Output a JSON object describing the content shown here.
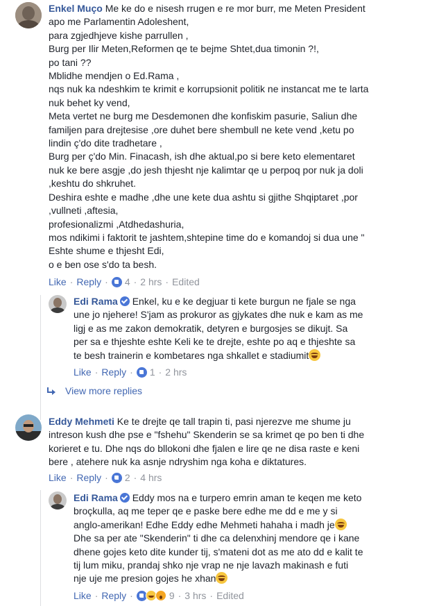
{
  "comments": [
    {
      "author": "Enkel Muço",
      "lines": [
        "Me ke do e nisesh rrugen e re mor burr, me Meten President",
        "apo me Parlamentin Adoleshent,",
        "para zgjedhjeve kishe parrullen ,",
        "Burg per Ilir Meten,Reformen qe te bejme Shtet,dua timonin ?!,",
        "po tani ??",
        "Mblidhe mendjen o Ed.Rama ,",
        "nqs nuk ka ndeshkim te krimit e korrupsionit politik ne instancat me te larta",
        "nuk behet ky vend,",
        "Meta vertet ne burg me Desdemonen dhe konfiskim pasurie, Saliun dhe",
        "familjen para drejtesise ,ore duhet bere shembull ne kete vend ,ketu po",
        "lindin ç'do dite tradhetare ,",
        "Burg per ç'do Min. Finacash, ish dhe aktual,po si bere keto elementaret",
        "nuk ke bere asgje ,do jesh thjesht nje kalimtar qe u perpoq por nuk ja doli",
        ",keshtu do shkruhet.",
        "Deshira eshte e madhe ,dhe une kete dua ashtu si gjithe Shqiptaret ,por",
        ",vullneti ,aftesia,",
        "profesionalizmi ,Atdhedashuria,",
        "mos ndikimi i faktorit te jashtem,shtepine time do e komandoj si dua une \"",
        "Eshte shume e thjesht Edi,",
        "o e ben ose s'do ta besh."
      ],
      "actions": {
        "like": "Like",
        "reply": "Reply",
        "reactions": "4",
        "time": "2 hrs",
        "edited": "Edited"
      }
    },
    {
      "author": "Edi Rama",
      "lines": [
        "Enkel, ku e ke degjuar ti kete burgun ne fjale se nga",
        "une jo njehere! S'jam as prokuror as gjykates dhe nuk e kam as me",
        "ligj e as me zakon demokratik, detyren e burgosjes se dikujt. Sa",
        "per sa e thjeshte eshte Keli ke te drejte, eshte po aq e thjeshte sa",
        "te besh trainerin e kombetares nga shkallet e stadiumit"
      ],
      "actions": {
        "like": "Like",
        "reply": "Reply",
        "reactions": "1",
        "time": "2 hrs"
      }
    },
    {
      "more_replies": "View more replies"
    },
    {
      "author": "Eddy Mehmeti",
      "lines": [
        "Ke te drejte qe tall trapin ti, pasi njerezve me shume ju",
        "intreson kush dhe pse e \"fshehu\" Skenderin se sa krimet qe po ben ti dhe",
        "korieret e tu. Dhe nqs do bllokoni dhe fjalen e lire qe ne disa raste e keni",
        "bere , atehere nuk ka asnje ndryshim nga koha e diktatures."
      ],
      "actions": {
        "like": "Like",
        "reply": "Reply",
        "reactions": "2",
        "time": "4 hrs"
      }
    },
    {
      "author": "Edi Rama",
      "lines": [
        "Eddy mos na e turpero emrin aman te keqen me keto",
        "broçkulla, aq me teper qe e paske bere edhe me dd e me y si",
        "anglo-amerikan! Edhe Eddy edhe Mehmeti hahaha i madh je",
        "Dhe sa per ate \"Skenderin\" ti dhe ca delenxhinj mendore qe i kane",
        "dhene gojes keto dite kunder tij, s'mateni dot as me ato dd e kalit te",
        "tij lum miku, prandaj shko nje vrap ne nje lavazh makinash e futi",
        "nje uje me presion gojes he xhan"
      ],
      "actions": {
        "like": "Like",
        "reply": "Reply",
        "reactions": "9",
        "time": "3 hrs",
        "edited": "Edited"
      }
    }
  ],
  "colors": {
    "author": "#365899",
    "link": "#4267b2",
    "meta": "#90949c",
    "text": "#1d2129"
  }
}
